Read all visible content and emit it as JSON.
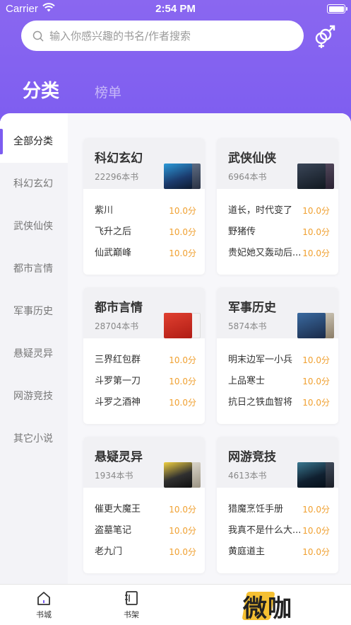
{
  "status_bar": {
    "carrier": "Carrier",
    "time": "2:54 PM"
  },
  "search": {
    "placeholder": "输入你感兴趣的书名/作者搜索"
  },
  "top_tabs": {
    "category": "分类",
    "rank": "榜单"
  },
  "sidebar": {
    "items": [
      "全部分类",
      "科幻玄幻",
      "武侠仙侠",
      "都市言情",
      "军事历史",
      "悬疑灵异",
      "网游竞技",
      "其它小说"
    ],
    "active_index": 0
  },
  "cards": [
    {
      "title": "科幻玄幻",
      "count": "22296本书",
      "books": [
        {
          "name": "紫川",
          "score": "10.0分"
        },
        {
          "name": "飞升之后",
          "score": "10.0分"
        },
        {
          "name": "仙武巅峰",
          "score": "10.0分"
        }
      ]
    },
    {
      "title": "武侠仙侠",
      "count": "6964本书",
      "books": [
        {
          "name": "道长，时代变了",
          "score": "10.0分"
        },
        {
          "name": "野猪传",
          "score": "10.0分"
        },
        {
          "name": "贵妃她又轰动后...",
          "score": "10.0分"
        }
      ]
    },
    {
      "title": "都市言情",
      "count": "28704本书",
      "books": [
        {
          "name": "三界红包群",
          "score": "10.0分"
        },
        {
          "name": "斗罗第一刀",
          "score": "10.0分"
        },
        {
          "name": "斗罗之酒神",
          "score": "10.0分"
        }
      ]
    },
    {
      "title": "军事历史",
      "count": "5874本书",
      "books": [
        {
          "name": "明末边军一小兵",
          "score": "10.0分"
        },
        {
          "name": "上品寒士",
          "score": "10.0分"
        },
        {
          "name": "抗日之铁血智将",
          "score": "10.0分"
        }
      ]
    },
    {
      "title": "悬疑灵异",
      "count": "1934本书",
      "books": [
        {
          "name": "催更大魔王",
          "score": "10.0分"
        },
        {
          "name": "盗墓笔记",
          "score": "10.0分"
        },
        {
          "name": "老九门",
          "score": "10.0分"
        }
      ]
    },
    {
      "title": "网游竞技",
      "count": "4613本书",
      "books": [
        {
          "name": "猎魔烹饪手册",
          "score": "10.0分"
        },
        {
          "name": "我真不是什么大...",
          "score": "10.0分"
        },
        {
          "name": "黄庭道主",
          "score": "10.0分"
        }
      ]
    }
  ],
  "tabbar": {
    "bookstore": "书城",
    "bookshelf": "书架"
  },
  "watermark": "微咖",
  "colors": {
    "accent": "#7c5cf0",
    "score": "#f0a030"
  }
}
